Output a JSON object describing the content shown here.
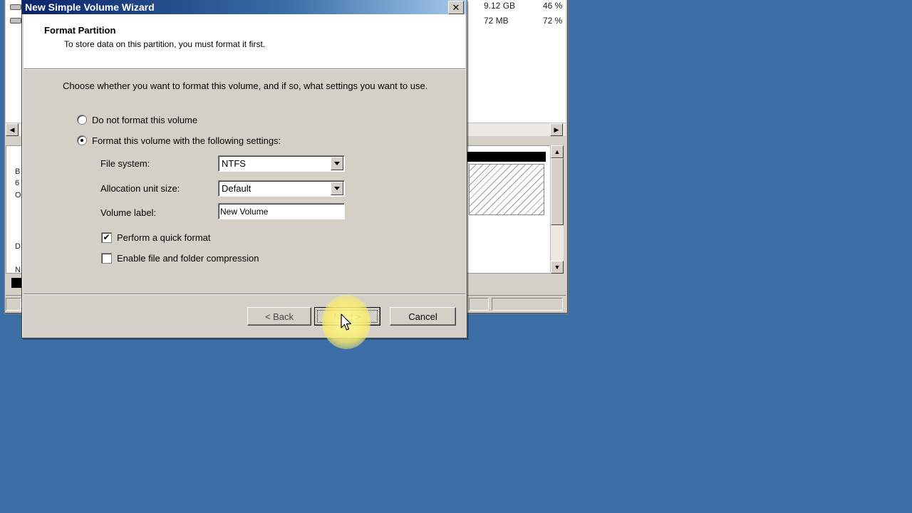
{
  "background_window": {
    "list_rows": [
      {
        "size": "9.12 GB",
        "percent": "46 %"
      },
      {
        "size": "72 MB",
        "percent": "72 %"
      }
    ],
    "left_letters": [
      "B",
      "6",
      "O",
      "D",
      "N"
    ]
  },
  "wizard": {
    "title": "New Simple Volume Wizard",
    "close_glyph": "✕",
    "header": {
      "title": "Format Partition",
      "subtitle": "To store data on this partition, you must format it first."
    },
    "instruction": "Choose whether you want to format this volume, and if so, what settings you want to use.",
    "options": {
      "no_format": {
        "label": "Do not format this volume",
        "selected": false
      },
      "format": {
        "label": "Format this volume with the following settings:",
        "selected": true
      }
    },
    "fields": {
      "file_system": {
        "label": "File system:",
        "value": "NTFS"
      },
      "allocation_unit": {
        "label": "Allocation unit size:",
        "value": "Default"
      },
      "volume_label": {
        "label": "Volume label:",
        "value": "New Volume"
      }
    },
    "checkboxes": {
      "quick_format": {
        "label": "Perform a quick format",
        "checked": true,
        "glyph": "✔"
      },
      "compression": {
        "label": "Enable file and folder compression",
        "checked": false,
        "glyph": ""
      }
    },
    "buttons": {
      "back": "< Back",
      "next": "Next >",
      "cancel": "Cancel"
    }
  },
  "colors": {
    "desktop": "#3a6ea5",
    "title_bar_start": "#0a246a",
    "dialog_face": "#d4d0c8",
    "cursor_highlight": "#f8ec80"
  }
}
